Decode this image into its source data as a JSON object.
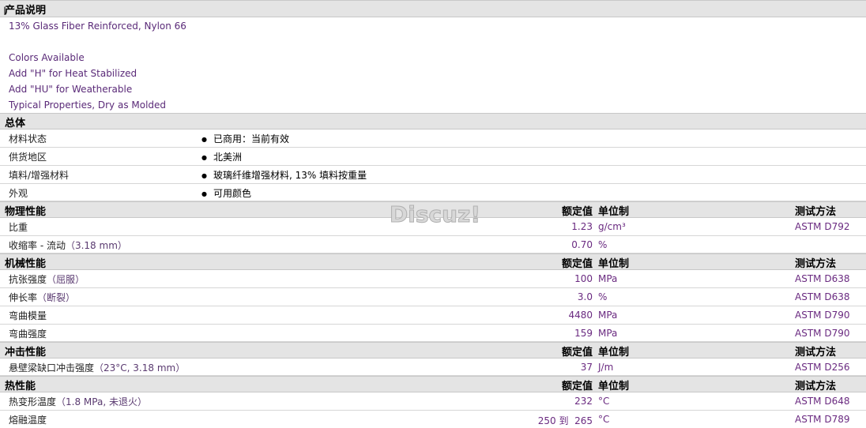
{
  "description": {
    "title": "产品说明",
    "lines": [
      "13% Glass Fiber Reinforced, Nylon 66",
      "Colors Available",
      "Add \"H\" for Heat Stabilized",
      "Add \"HU\" for Weatherable",
      "Typical Properties, Dry as Molded"
    ]
  },
  "general": {
    "title": "总体",
    "rows": [
      {
        "label": "材料状态",
        "value": "已商用：当前有效"
      },
      {
        "label": "供货地区",
        "value": "北美洲"
      },
      {
        "label": "填料/增强材料",
        "value": "玻璃纤维增强材料, 13% 填料按重量"
      },
      {
        "label": "外观",
        "value": "可用颜色"
      }
    ]
  },
  "headers": {
    "nominal": "额定值",
    "unit": "单位制",
    "method": "测试方法"
  },
  "physical": {
    "title": "物理性能",
    "rows": [
      {
        "label": "比重",
        "sub": "",
        "value": "1.23",
        "unit": "g/cm³",
        "method": "ASTM D792"
      },
      {
        "label": "收缩率 - 流动",
        "sub": "（3.18 mm）",
        "value": "0.70",
        "unit": "%",
        "method": ""
      }
    ]
  },
  "mechanical": {
    "title": "机械性能",
    "rows": [
      {
        "label": "抗张强度",
        "sub": "（屈服）",
        "value": "100",
        "unit": "MPa",
        "method": "ASTM D638"
      },
      {
        "label": "伸长率",
        "sub": "（断裂）",
        "value": "3.0",
        "unit": "%",
        "method": "ASTM D638"
      },
      {
        "label": "弯曲模量",
        "sub": "",
        "value": "4480",
        "unit": "MPa",
        "method": "ASTM D790"
      },
      {
        "label": "弯曲强度",
        "sub": "",
        "value": "159",
        "unit": "MPa",
        "method": "ASTM D790"
      }
    ]
  },
  "impact": {
    "title": "冲击性能",
    "rows": [
      {
        "label": "悬壁梁缺口冲击强度",
        "sub": "（23°C, 3.18 mm）",
        "value": "37",
        "unit": "J/m",
        "method": "ASTM D256"
      }
    ]
  },
  "thermal": {
    "title": "热性能",
    "rows": [
      {
        "label": "热变形温度",
        "sub": "（1.8 MPa, 未退火）",
        "value": "232",
        "unit": "°C",
        "method": "ASTM D648"
      },
      {
        "label": "熔融温度",
        "sub": "",
        "value": "250 到  265",
        "unit": "°C",
        "method": "ASTM D789"
      }
    ]
  },
  "watermark": "Discuz!"
}
